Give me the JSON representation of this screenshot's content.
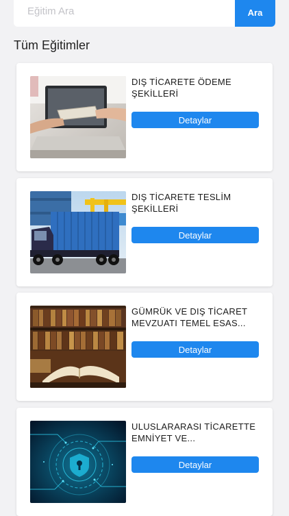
{
  "search": {
    "placeholder": "Eğitim Ara",
    "button_label": "Ara"
  },
  "section": {
    "title": "Tüm Eğitimler"
  },
  "courses": [
    {
      "title": "DIŞ TİCARETE ÖDEME ŞEKİLLERİ",
      "button_label": "Detaylar",
      "image": "payment-handover-photo"
    },
    {
      "title": "DIŞ TİCARETE TESLİM ŞEKİLLERİ",
      "button_label": "Detaylar",
      "image": "truck-container-photo"
    },
    {
      "title": "GÜMRÜK VE DIŞ TİCARET MEVZUATI TEMEL ESAS...",
      "button_label": "Detaylar",
      "image": "law-books-photo"
    },
    {
      "title": "ULUSLARARASI TİCARETTE EMNİYET VE...",
      "button_label": "Detaylar",
      "image": "cyber-security-lock-photo"
    }
  ],
  "colors": {
    "accent": "#1e87ee",
    "background": "#f2f2f4",
    "card": "#ffffff"
  }
}
